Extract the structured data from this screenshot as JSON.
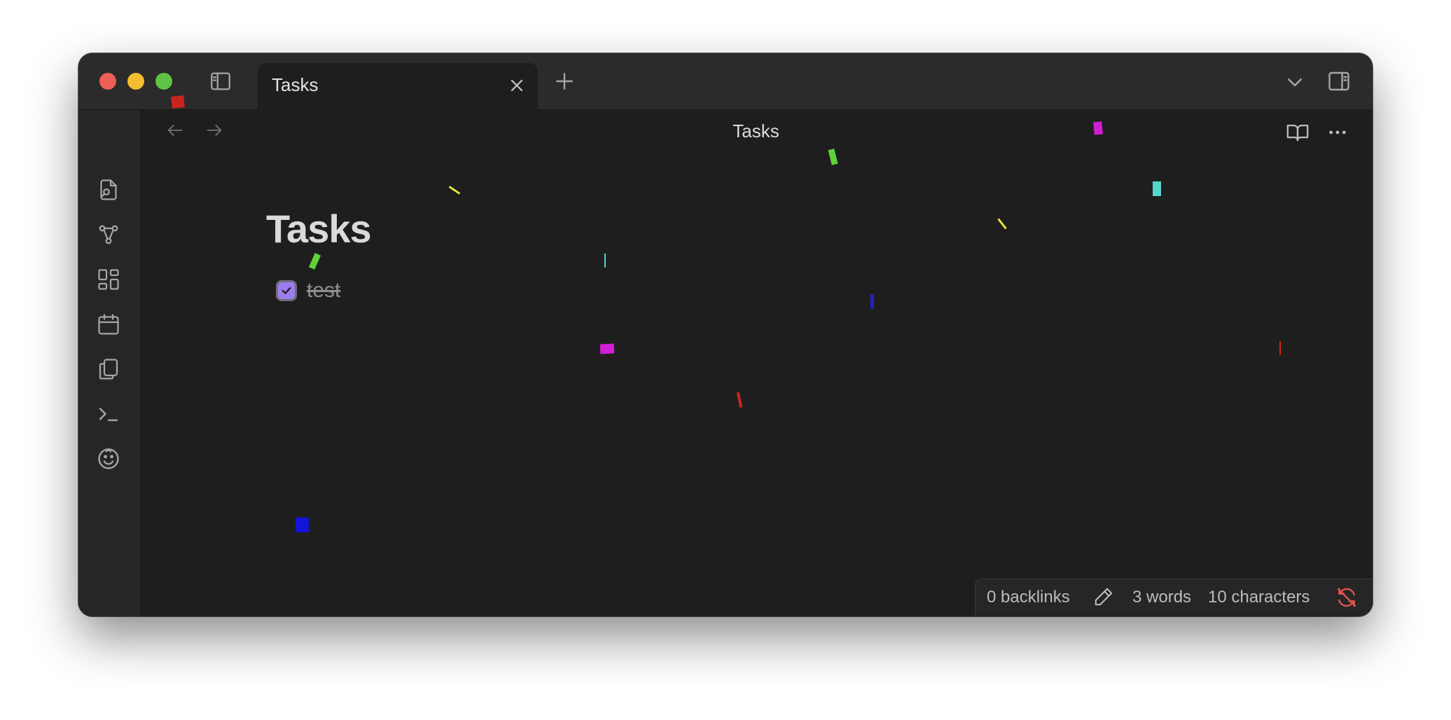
{
  "window": {
    "tab": {
      "title": "Tasks"
    }
  },
  "view_header": {
    "title": "Tasks"
  },
  "note": {
    "title": "Tasks",
    "tasks": [
      {
        "text": "test",
        "checked": true
      }
    ]
  },
  "status_bar": {
    "backlinks": "0 backlinks",
    "words": "3 words",
    "characters": "10 characters",
    "sync_status_color": "#e4534a"
  },
  "ribbon": {
    "icons": [
      "open-quick-switcher-icon",
      "graph-view-icon",
      "canvas-icon",
      "daily-note-calendar-icon",
      "templates-icon",
      "command-palette-icon",
      "confetti-face-icon"
    ]
  },
  "colors": {
    "accent": "#9d7cf0",
    "background": "#1e1e1e",
    "titlebar": "#2b2b2b"
  }
}
